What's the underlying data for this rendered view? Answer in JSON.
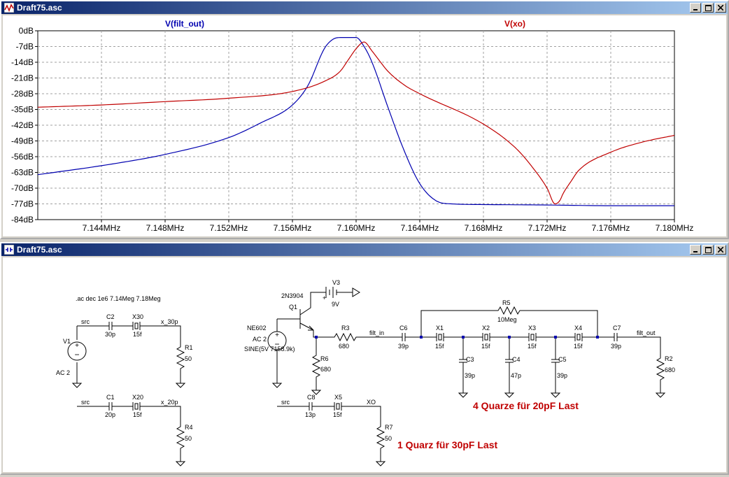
{
  "plot_window": {
    "title": "Draft75.asc",
    "trace_labels": {
      "filt_out": "V(filt_out)",
      "xo": "V(xo)"
    },
    "y_ticks": [
      "0dB",
      "-7dB",
      "-14dB",
      "-21dB",
      "-28dB",
      "-35dB",
      "-42dB",
      "-49dB",
      "-56dB",
      "-63dB",
      "-70dB",
      "-77dB",
      "-84dB"
    ],
    "x_ticks": [
      "7.144MHz",
      "7.148MHz",
      "7.152MHz",
      "7.156MHz",
      "7.160MHz",
      "7.164MHz",
      "7.168MHz",
      "7.172MHz",
      "7.176MHz",
      "7.180MHz"
    ],
    "colors": {
      "filt_out": "#0000b0",
      "xo": "#c00000",
      "grid": "#a0a0a0"
    }
  },
  "chart_data": {
    "type": "line",
    "xlabel": "",
    "ylabel": "",
    "xlim": [
      7.14,
      7.18
    ],
    "ylim": [
      -84,
      0
    ],
    "grid": true,
    "series": [
      {
        "name": "V(filt_out)",
        "x": [
          7.14,
          7.144,
          7.148,
          7.152,
          7.154,
          7.156,
          7.157,
          7.158,
          7.1585,
          7.159,
          7.16,
          7.1605,
          7.161,
          7.162,
          7.163,
          7.164,
          7.165,
          7.166,
          7.168,
          7.172,
          7.176,
          7.18
        ],
        "y": [
          -64,
          -60,
          -55,
          -47.5,
          -41,
          -33,
          -24,
          -8,
          -4,
          -3,
          -3,
          -7,
          -14,
          -34,
          -53,
          -68,
          -75.5,
          -77,
          -77.3,
          -77.5,
          -77.8,
          -77.8
        ]
      },
      {
        "name": "V(xo)",
        "x": [
          7.14,
          7.144,
          7.148,
          7.152,
          7.156,
          7.158,
          7.159,
          7.1595,
          7.16,
          7.1605,
          7.161,
          7.162,
          7.163,
          7.164,
          7.168,
          7.17,
          7.171,
          7.172,
          7.1725,
          7.1728,
          7.173,
          7.1735,
          7.174,
          7.176,
          7.178,
          7.18
        ],
        "y": [
          -34,
          -33,
          -31.5,
          -30,
          -27,
          -22.5,
          -18,
          -13,
          -8,
          -5,
          -9,
          -18,
          -24,
          -28,
          -41.5,
          -52,
          -60,
          -70,
          -77,
          -75.5,
          -72.5,
          -67,
          -62,
          -54,
          -49.5,
          -46.5
        ]
      }
    ]
  },
  "schematic_window": {
    "title": "Draft75.asc",
    "directive": ".ac dec 1e6 7.14Meg 7.18Meg",
    "notes": {
      "four": "4 Quarze für 20pF Last",
      "one": "1 Quarz für 30pF Last"
    },
    "labels": {
      "src": "src",
      "x_30p": "x_30p",
      "x_20p": "x_20p",
      "xo": "XO",
      "filt_in": "filt_in",
      "filt_out": "filt_out",
      "v1": "V1",
      "v1_val": "AC 2",
      "c2": "C2",
      "c2_val": "30p",
      "x30": "X30",
      "x30_val": "15f",
      "r1": "R1",
      "r1_val": "50",
      "c1": "C1",
      "c1_val": "20p",
      "x20": "X20",
      "x20_val": "15f",
      "r4": "R4",
      "r4_val": "50",
      "q1_type": "2N3904",
      "q1": "Q1",
      "v3": "V3",
      "v3_val": "9V",
      "plus": "+",
      "ne602": "NE602",
      "ac2": "AC 2",
      "sine": "SINE(5V 7158.9k)",
      "r3": "R3",
      "r3_val": "680",
      "r6": "R6",
      "r6_val": "680",
      "c8": "C8",
      "c8_val": "13p",
      "x5": "X5",
      "x5_val": "15f",
      "r7": "R7",
      "r7_val": "50",
      "c6": "C6",
      "c6_val": "39p",
      "r5": "R5",
      "r5_val": "10Meg",
      "x1": "X1",
      "x1_val": "15f",
      "x2": "X2",
      "x2_val": "15f",
      "x3": "X3",
      "x3_val": "15f",
      "x4": "X4",
      "x4_val": "15f",
      "c3": "C3",
      "c3_val": "39p",
      "c4": "C4",
      "c4_val": "47p",
      "c5": "C5",
      "c5_val": "39p",
      "c7": "C7",
      "c7_val": "39p",
      "r2": "R2",
      "r2_val": "680"
    }
  }
}
